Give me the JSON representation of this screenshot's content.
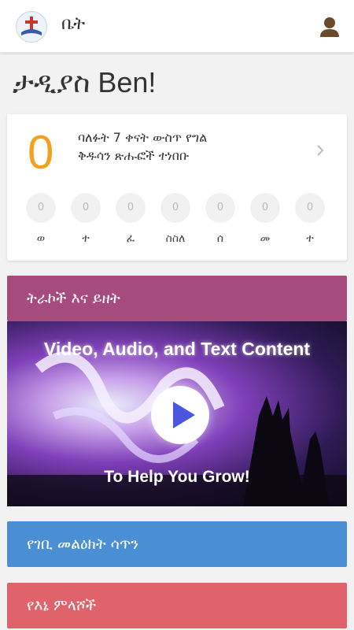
{
  "appbar": {
    "logo_icon": "church-logo-icon",
    "title": "ቤት",
    "profile_icon": "user-profile-icon"
  },
  "greeting": "ታዲያስ Ben!",
  "streak": {
    "count": "0",
    "description": "ባለፉት 7 ቀናት ውስጥ የግል ቅዱሳን ጽሑፎች ተነበቡ",
    "count_color": "#f2a01e",
    "days": [
      {
        "value": "0",
        "label": "ወ"
      },
      {
        "value": "0",
        "label": "ተ"
      },
      {
        "value": "0",
        "label": "ፈ"
      },
      {
        "value": "0",
        "label": "ስስለ"
      },
      {
        "value": "0",
        "label": "ሰ"
      },
      {
        "value": "0",
        "label": "መ"
      },
      {
        "value": "0",
        "label": "ተ"
      }
    ]
  },
  "sections": {
    "topics": {
      "label": "ትራኮች እና ይዘት",
      "color": "#a64c7c"
    },
    "hero": {
      "title": "Video, Audio, and Text Content",
      "subtitle": "To Help You Grow!",
      "play_icon": "play-icon"
    },
    "devotion": {
      "label": "የገቢ መልዕክት ሳጥን",
      "color": "#4a8fd3"
    },
    "answers": {
      "label": "የእኔ ምላሾች",
      "color": "#e0636c"
    }
  }
}
